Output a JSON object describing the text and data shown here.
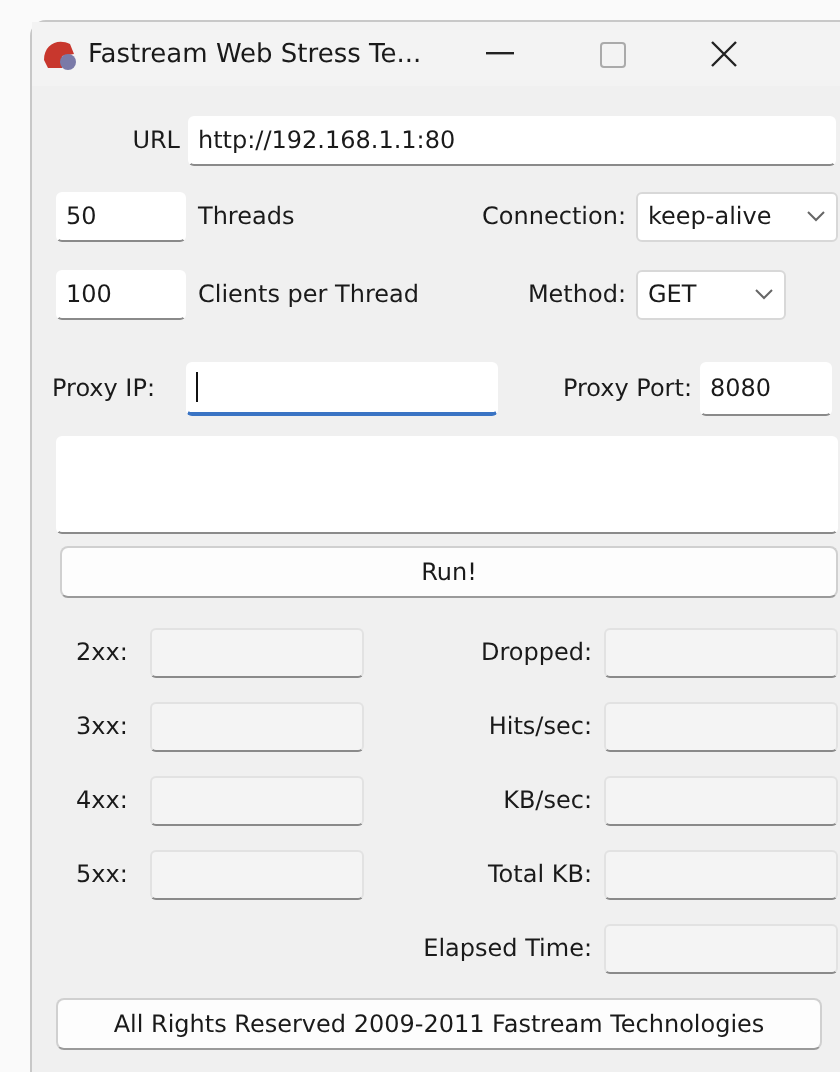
{
  "window": {
    "title": "Fastream Web Stress Te..."
  },
  "url": {
    "label": "URL",
    "value": "http://192.168.1.1:80"
  },
  "threads": {
    "value": "50",
    "label": "Threads"
  },
  "clients": {
    "value": "100",
    "label": "Clients per Thread"
  },
  "connection": {
    "label": "Connection:",
    "value": "keep-alive"
  },
  "method": {
    "label": "Method:",
    "value": "GET"
  },
  "proxy_ip": {
    "label": "Proxy IP:",
    "focused": true
  },
  "proxy_port": {
    "label": "Proxy Port:",
    "value": "8080"
  },
  "run_button": {
    "label": "Run!"
  },
  "stats_left": [
    {
      "label": "2xx:"
    },
    {
      "label": "3xx:"
    },
    {
      "label": "4xx:"
    },
    {
      "label": "5xx:"
    }
  ],
  "stats_right": [
    {
      "label": "Dropped:"
    },
    {
      "label": "Hits/sec:"
    },
    {
      "label": "KB/sec:"
    },
    {
      "label": "Total KB:"
    },
    {
      "label": "Elapsed Time:"
    }
  ],
  "footer": {
    "label": "All Rights Reserved 2009-2011 Fastream Technologies"
  }
}
